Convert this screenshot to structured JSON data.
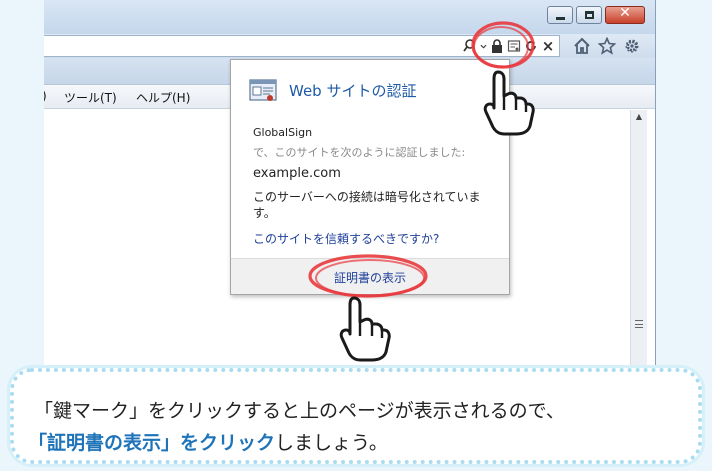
{
  "menu": {
    "partial_paren": ")",
    "tools": "ツール(T)",
    "help": "ヘルプ(H)"
  },
  "address_icons": {
    "search": "search-icon",
    "lock": "lock-icon",
    "certificate": "certificate-icon",
    "refresh": "refresh-icon",
    "stop": "×"
  },
  "nav_icons": [
    "home-icon",
    "star-icon",
    "gear-icon"
  ],
  "popup": {
    "title": "Web サイトの認証",
    "issuer": "GlobalSign",
    "issuer_desc": "で、このサイトを次のように認証しました:",
    "domain": "example.com",
    "encryption": "このサーバーへの接続は暗号化されています。",
    "trust_link": "このサイトを信頼するべきですか?",
    "view_certificate": "証明書の表示"
  },
  "banner": {
    "line1": "「鍵マーク」をクリックすると上のページが表示されるので、",
    "line2_highlight": "「証明書の表示」をクリック",
    "line2_rest": "しましょう。"
  },
  "colors": {
    "highlight_circle": "#e8383d",
    "link_blue": "#1f3f9a",
    "banner_highlight": "#1e73b9",
    "banner_border": "#a9dcef"
  }
}
